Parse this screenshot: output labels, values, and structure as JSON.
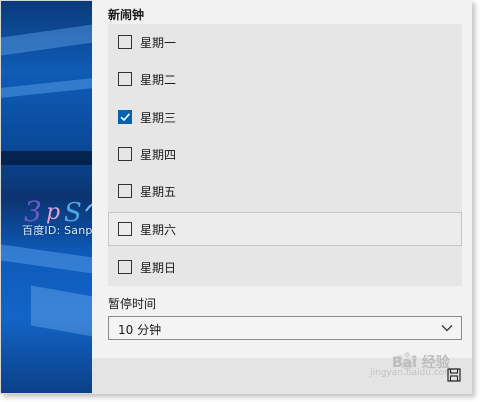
{
  "section_title": "新闹钟",
  "days": [
    {
      "label": "星期一",
      "checked": false
    },
    {
      "label": "星期二",
      "checked": false
    },
    {
      "label": "星期三",
      "checked": true
    },
    {
      "label": "星期四",
      "checked": false
    },
    {
      "label": "星期五",
      "checked": false
    },
    {
      "label": "星期六",
      "checked": false
    },
    {
      "label": "星期日",
      "checked": false
    }
  ],
  "snooze": {
    "label": "暂停时间",
    "value": "10 分钟"
  },
  "watermarks": {
    "left_text": "百度ID: Sanpitt",
    "bottom_text": "Bai 经验",
    "bottom_url": "jingyan.baidu.com"
  },
  "colors": {
    "accent": "#0063b1",
    "panel_bg": "#f2f2f2",
    "days_bg": "#e6e6e6"
  }
}
